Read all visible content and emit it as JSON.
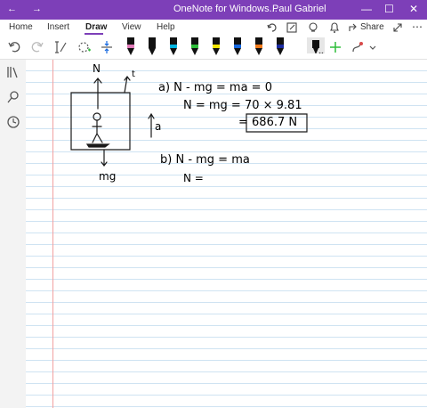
{
  "window": {
    "title": "OneNote for Windows...",
    "user": "Paul Gabriel",
    "minimize": "—",
    "maximize": "☐",
    "close": "✕"
  },
  "menu": {
    "home": "Home",
    "insert": "Insert",
    "draw": "Draw",
    "view": "View",
    "help": "Help",
    "share": "Share"
  },
  "pens": [
    {
      "name": "pen-black-pink-band",
      "color": "#111111",
      "band": "#e07ab8"
    },
    {
      "name": "pen-black",
      "color": "#111111",
      "band": "#111111"
    },
    {
      "name": "pen-cyan",
      "color": "#111111",
      "band": "#00b4e0"
    },
    {
      "name": "pen-green",
      "color": "#111111",
      "band": "#2ebd3a"
    },
    {
      "name": "highlighter-yellow",
      "color": "#111111",
      "band": "#f3e600"
    },
    {
      "name": "pen-blue",
      "color": "#111111",
      "band": "#1769e0"
    },
    {
      "name": "pen-orange",
      "color": "#111111",
      "band": "#f07a1a"
    },
    {
      "name": "pen-darkblue",
      "color": "#111111",
      "band": "#1a2aa0"
    },
    {
      "name": "pen-black-selected",
      "color": "#111111",
      "band": "#111111"
    }
  ],
  "notes": {
    "label_N": "N",
    "label_t": "t",
    "label_a": "a",
    "label_mg": "mg",
    "part_a_line1": "a) N - mg = ma = 0",
    "part_a_line2": "N = mg = 70 × 9.81",
    "part_a_result": "= 686.7 N",
    "part_b_line1": "b) N - mg = ma",
    "part_b_line2": "N ="
  }
}
